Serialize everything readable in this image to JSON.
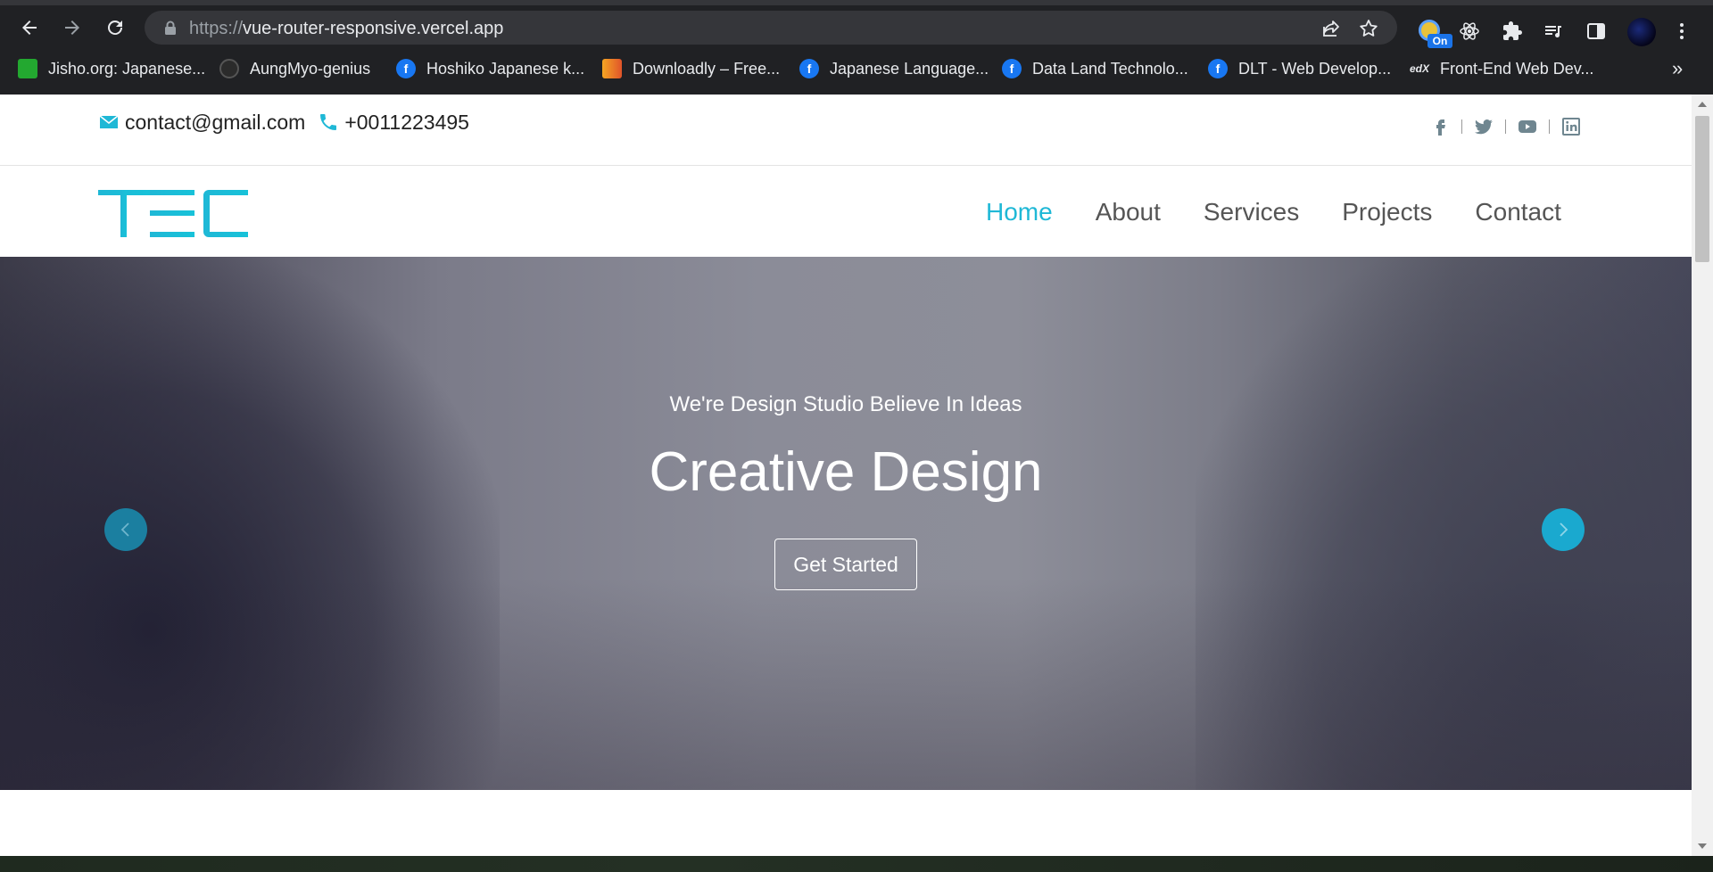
{
  "browser": {
    "url_scheme": "https://",
    "url_host": "vue-router-responsive.vercel.app",
    "extension_badge": "On",
    "bookmarks": [
      {
        "label": "Jisho.org: Japanese...",
        "icon": "jisho-icon"
      },
      {
        "label": "AungMyo-genius",
        "icon": "github-icon"
      },
      {
        "label": "Hoshiko Japanese k...",
        "icon": "facebook-icon"
      },
      {
        "label": "Downloadly – Free...",
        "icon": "downloadly-icon"
      },
      {
        "label": "Japanese Language...",
        "icon": "facebook-icon"
      },
      {
        "label": "Data Land Technolo...",
        "icon": "facebook-icon"
      },
      {
        "label": "DLT - Web Develop...",
        "icon": "facebook-icon"
      },
      {
        "label": "Front-End Web Dev...",
        "icon": "edx-icon"
      }
    ],
    "more_bookmarks": "»"
  },
  "topbar": {
    "email": "contact@gmail.com",
    "phone": "+0011223495",
    "socials": [
      "facebook-icon",
      "twitter-icon",
      "youtube-icon",
      "linkedin-icon"
    ]
  },
  "navbar": {
    "logo_text": "TEC",
    "menu": [
      "Home",
      "About",
      "Services",
      "Projects",
      "Contact"
    ],
    "active_index": 0
  },
  "hero": {
    "subtitle": "We're Design Studio Believe In Ideas",
    "title": "Creative Design",
    "button": "Get Started",
    "slides": 3,
    "active_slide": 0
  },
  "colors": {
    "accent": "#1fb8d6",
    "chrome_bg": "#202124",
    "omnibox_bg": "#35363a",
    "nav_text": "#555555"
  }
}
